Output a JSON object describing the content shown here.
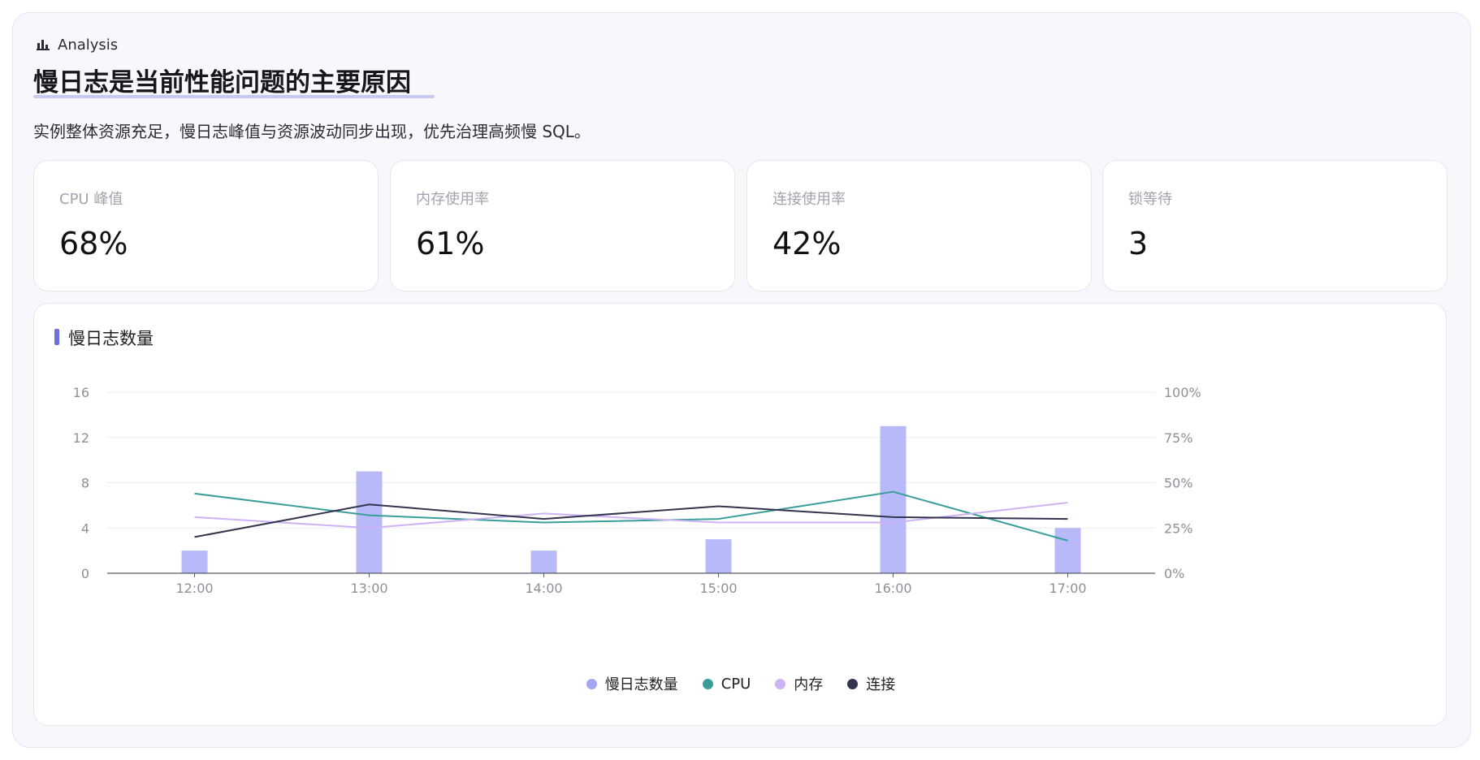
{
  "header": {
    "tag": "Analysis",
    "title": "慢日志是当前性能问题的主要原因",
    "subtitle": "实例整体资源充足，慢日志峰值与资源波动同步出现，优先治理高频慢 SQL。"
  },
  "metrics": [
    {
      "label": "CPU 峰值",
      "value": "68%"
    },
    {
      "label": "内存使用率",
      "value": "61%"
    },
    {
      "label": "连接使用率",
      "value": "42%"
    },
    {
      "label": "锁等待",
      "value": "3"
    }
  ],
  "chart_data": {
    "type": "bar",
    "title": "慢日志数量",
    "categories": [
      "12:00",
      "13:00",
      "14:00",
      "15:00",
      "16:00",
      "17:00"
    ],
    "y_left": {
      "ylim": [
        0,
        16
      ],
      "ticks": [
        "0",
        "4",
        "8",
        "12",
        "16"
      ]
    },
    "y_right": {
      "ylim": [
        0,
        100
      ],
      "ticks": [
        "0%",
        "25%",
        "50%",
        "75%",
        "100%"
      ]
    },
    "grid": true,
    "legend_position": "bottom",
    "series": [
      {
        "name": "慢日志数量",
        "type": "bar",
        "axis": "left",
        "color": "#b8b9f8",
        "values": [
          2,
          9,
          2,
          3,
          13,
          4
        ]
      },
      {
        "name": "CPU",
        "type": "line",
        "axis": "right",
        "color": "#3a9e98",
        "values": [
          44,
          32,
          28,
          30,
          45,
          18
        ]
      },
      {
        "name": "内存",
        "type": "line",
        "axis": "right",
        "color": "#cdb3f5",
        "values": [
          31,
          25,
          33,
          28,
          28,
          39
        ]
      },
      {
        "name": "连接",
        "type": "line",
        "axis": "right",
        "color": "#34344f",
        "values": [
          20,
          38,
          30,
          37,
          31,
          30
        ]
      }
    ]
  }
}
